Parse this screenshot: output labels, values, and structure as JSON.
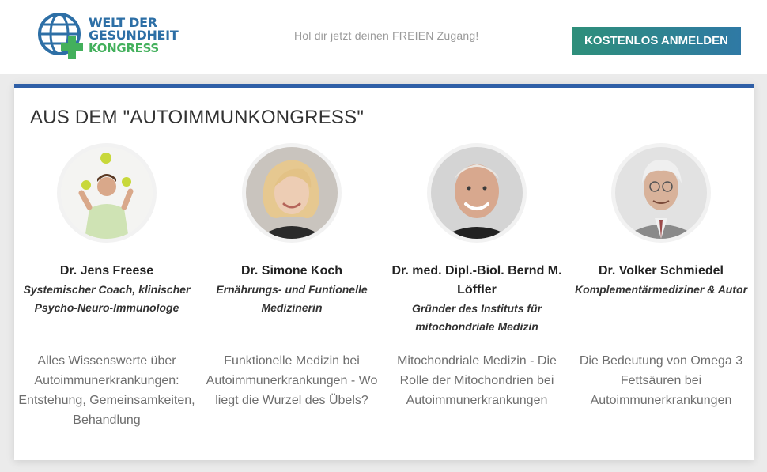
{
  "header": {
    "logo": {
      "line1": "WELT DER",
      "line2": "GESUNDHEIT",
      "line3": "KONGRESS"
    },
    "tagline": "Hol dir jetzt deinen FREIEN Zugang!",
    "cta_label": "KOSTENLOS ANMELDEN"
  },
  "colors": {
    "accent_blue": "#2f5fa7",
    "logo_blue": "#2d6fa6",
    "logo_green": "#43b05c",
    "cta_gradient_start": "#2e8f7a",
    "cta_gradient_end": "#2f79a5"
  },
  "section": {
    "title": "AUS DEM \"AUTOIMMUNKONGRESS\"",
    "speakers": [
      {
        "name": "Dr. Jens Freese",
        "role": "Systemischer Coach, klinischer Psycho-Neuro-Immunologe",
        "talk": "Alles Wissenswerte über Autoimmunerkrankungen: Entstehung, Gemeinsamkeiten, Behandlung"
      },
      {
        "name": "Dr. Simone Koch",
        "role": "Ernährungs- und Funtionelle Medizinerin",
        "talk": "Funktionelle Medizin bei Autoimmunerkrankungen - Wo liegt die Wurzel des Übels?"
      },
      {
        "name": "Dr. med. Dipl.-Biol. Bernd M. Löffler",
        "role": "Gründer des Instituts für mitochondriale Medizin",
        "talk": "Mitochondriale Medizin - Die Rolle der Mitochondrien bei Autoimmunerkrankungen"
      },
      {
        "name": "Dr. Volker Schmiedel",
        "role": "Komplementärmediziner & Autor",
        "talk": "Die Bedeutung von Omega 3 Fettsäuren bei Autoimmunerkrankungen"
      }
    ]
  }
}
